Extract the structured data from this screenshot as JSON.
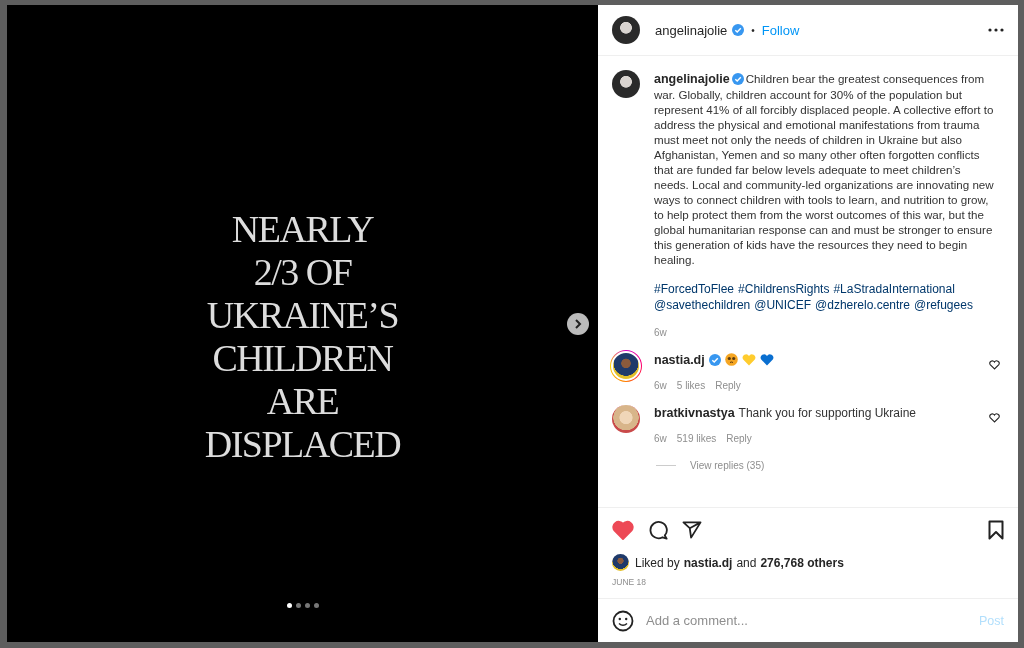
{
  "post": {
    "image_lines": [
      "NEARLY",
      "2/3 OF",
      "UKRAINE’S",
      "CHILDREN",
      "ARE",
      "DISPLACED"
    ],
    "slides": [
      {
        "selected": true
      },
      {
        "selected": false
      },
      {
        "selected": false
      },
      {
        "selected": false
      }
    ]
  },
  "header": {
    "username": "angelinajolie",
    "verified": true,
    "separator": "•",
    "follow": "Follow"
  },
  "caption": {
    "username": "angelinajolie",
    "verified": true,
    "text": "Children bear the greatest consequences from war. Globally, children account for 30% of the population but represent 41% of all forcibly displaced people. A collective effort to address the physical and emotional manifestations from trauma must meet not only the needs of children in Ukraine but also Afghanistan, Yemen and so many other often forgotten conflicts that are funded far below levels adequate to meet children’s needs. Local and community-led organizations are innovating new ways to connect children with tools to learn, and nutrition to grow, to help protect them from the worst outcomes of this war, but the global humanitarian response can and must be stronger to ensure this generation of kids have the resources they need to begin healing.",
    "tags": [
      "#ForcedToFlee",
      "#ChildrensRights",
      "#LaStradaInternational",
      "@savethechildren",
      "@UNICEF",
      "@dzherelo.centre",
      "@refugees"
    ],
    "age": "6w"
  },
  "comments": [
    {
      "kind": "emoji",
      "username": "nastia.dj",
      "verified": true,
      "story_ring": true,
      "age": "6w",
      "likes": "5 likes",
      "reply": "Reply"
    },
    {
      "kind": "text",
      "username": "bratkivnastya",
      "verified": false,
      "story_ring": false,
      "text": "Thank you for supporting Ukraine",
      "age": "6w",
      "likes": "519 likes",
      "reply": "Reply",
      "view_replies": "View replies (35)"
    }
  ],
  "actions": {
    "liked": true,
    "saved": false
  },
  "likes": {
    "prefix": "Liked by",
    "user": "nastia.dj",
    "middle": "and",
    "others": "276,768 others"
  },
  "date": "JUNE 18",
  "comment_box": {
    "placeholder": "Add a comment...",
    "post": "Post"
  }
}
